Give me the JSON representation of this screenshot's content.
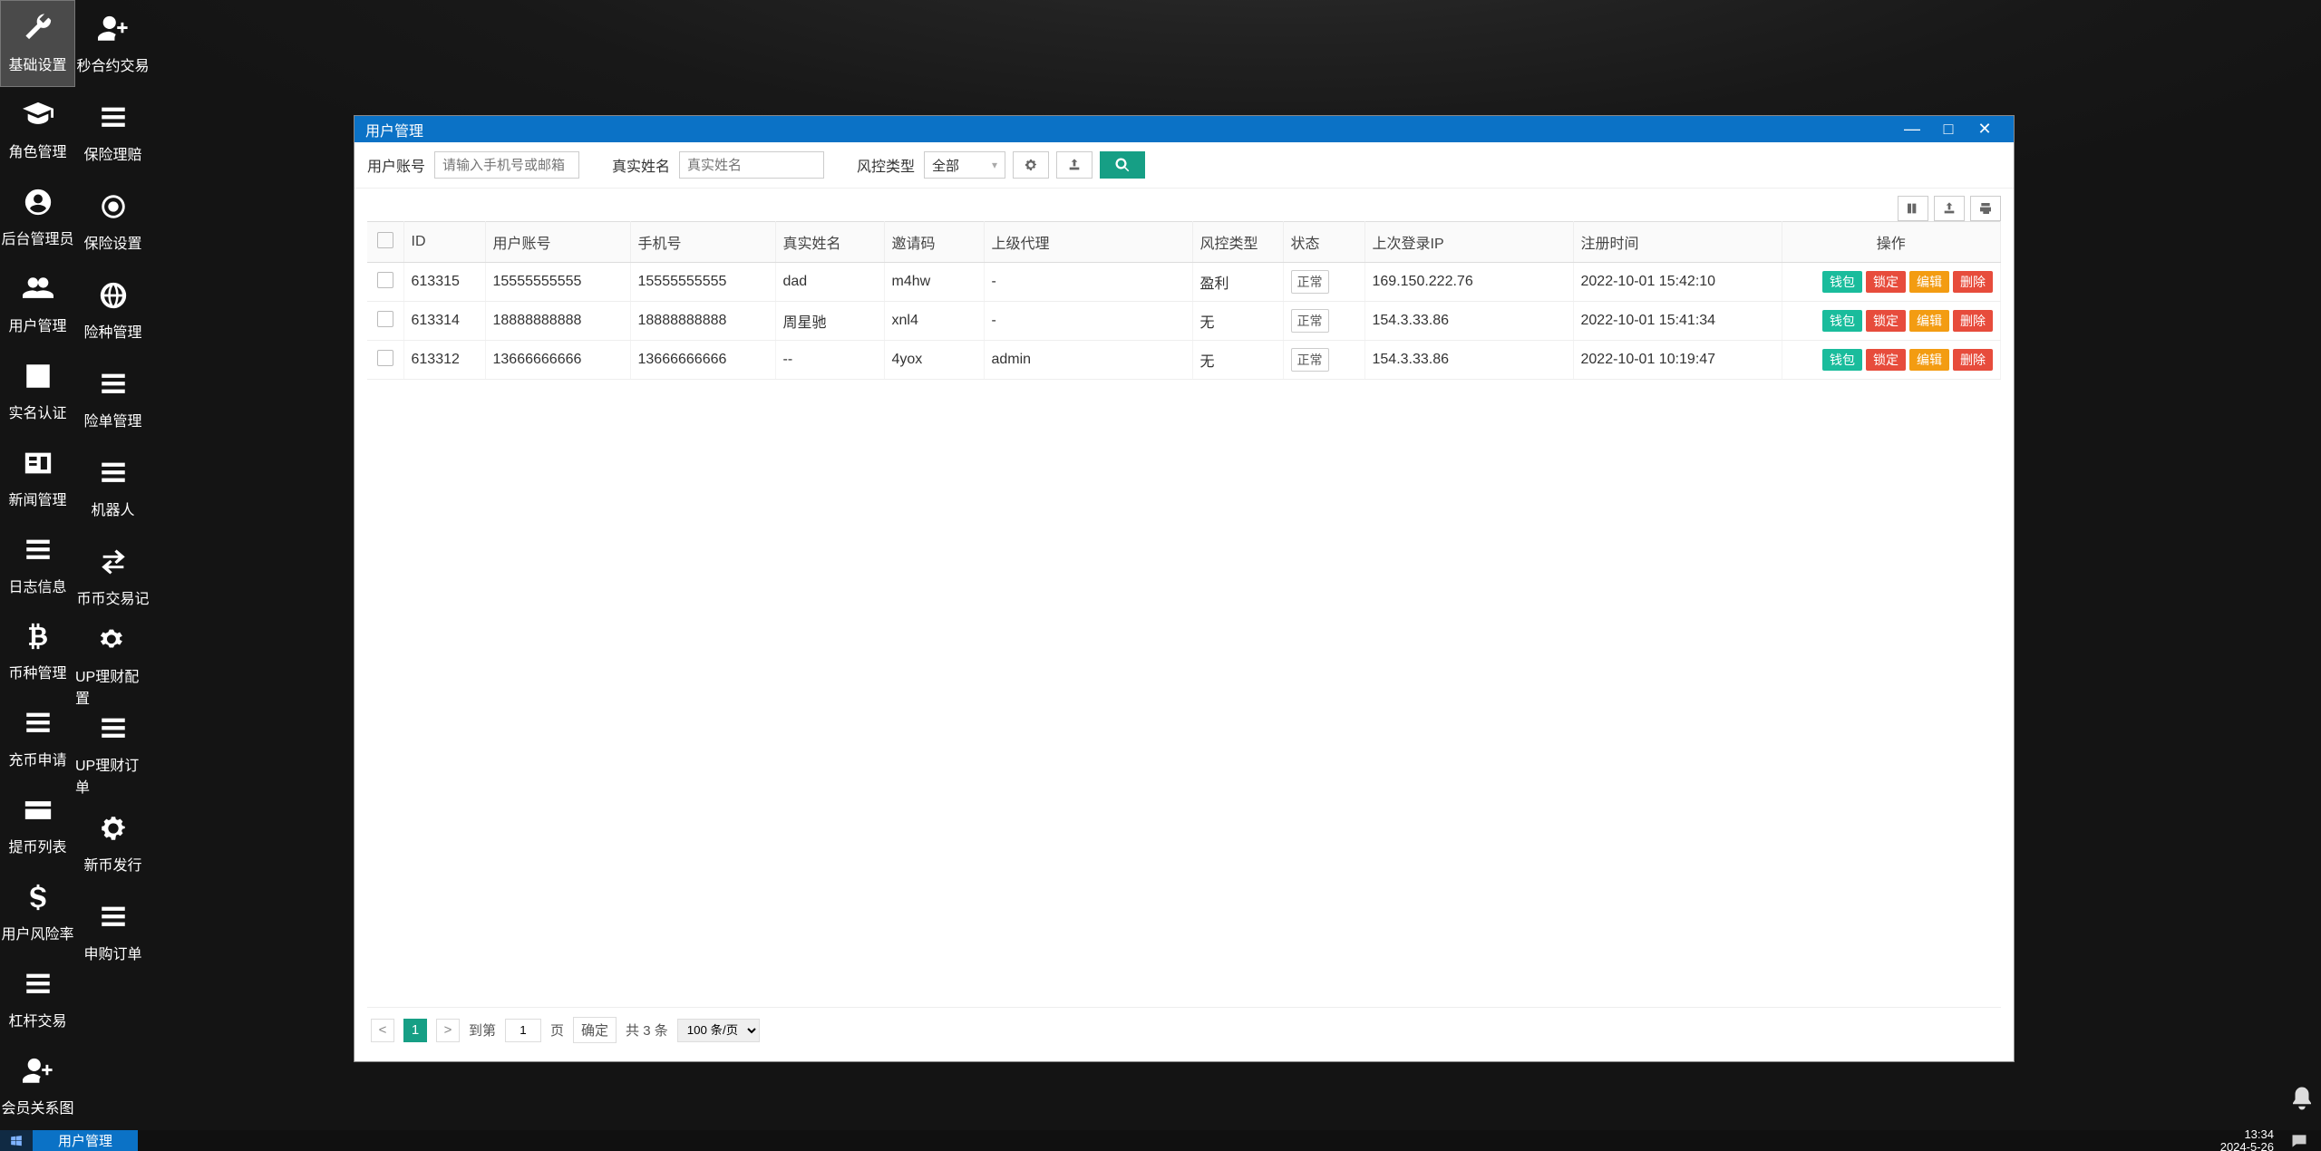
{
  "nav": {
    "left": [
      {
        "icon": "wrench",
        "label": "基础设置",
        "highlight": true
      },
      {
        "icon": "gradcap",
        "label": "角色管理"
      },
      {
        "icon": "usercircle",
        "label": "后台管理员"
      },
      {
        "icon": "users",
        "label": "用户管理"
      },
      {
        "icon": "checksq",
        "label": "实名认证"
      },
      {
        "icon": "idcard",
        "label": "新闻管理"
      },
      {
        "icon": "list",
        "label": "日志信息"
      },
      {
        "icon": "bitcoin",
        "label": "币种管理"
      },
      {
        "icon": "list",
        "label": "充币申请"
      },
      {
        "icon": "card",
        "label": "提币列表"
      },
      {
        "icon": "dollar",
        "label": "用户风险率"
      },
      {
        "icon": "list",
        "label": "杠杆交易"
      },
      {
        "icon": "useradd",
        "label": "会员关系图"
      }
    ],
    "right": [
      {
        "icon": "useradd",
        "label": "秒合约交易"
      },
      {
        "icon": "list",
        "label": "保险理赔"
      },
      {
        "icon": "gearring",
        "label": "保险设置"
      },
      {
        "icon": "globe",
        "label": "险种管理"
      },
      {
        "icon": "list",
        "label": "险单管理"
      },
      {
        "icon": "list",
        "label": "机器人"
      },
      {
        "icon": "swap",
        "label": "币币交易记"
      },
      {
        "icon": "gears",
        "label": "UP理财配置"
      },
      {
        "icon": "list",
        "label": "UP理财订单"
      },
      {
        "icon": "gear",
        "label": "新币发行"
      },
      {
        "icon": "list",
        "label": "申购订单"
      }
    ]
  },
  "window": {
    "title": "用户管理"
  },
  "filters": {
    "account_label": "用户账号",
    "account_placeholder": "请输入手机号或邮箱",
    "name_label": "真实姓名",
    "name_placeholder": "真实姓名",
    "risk_label": "风控类型",
    "risk_selected": "全部"
  },
  "columns": {
    "id": "ID",
    "account": "用户账号",
    "phone": "手机号",
    "realname": "真实姓名",
    "invite": "邀请码",
    "upline": "上级代理",
    "risk": "风控类型",
    "status": "状态",
    "ip": "上次登录IP",
    "regtime": "注册时间",
    "ops": "操作"
  },
  "status_normal": "正常",
  "ops": {
    "wallet": "钱包",
    "lock": "锁定",
    "edit": "编辑",
    "del": "删除"
  },
  "rows": [
    {
      "id": "613315",
      "account": "15555555555",
      "phone": "15555555555",
      "realname": "dad",
      "invite": "m4hw",
      "upline": "-",
      "risk": "盈利",
      "status": "正常",
      "ip": "169.150.222.76",
      "regtime": "2022-10-01 15:42:10"
    },
    {
      "id": "613314",
      "account": "18888888888",
      "phone": "18888888888",
      "realname": "周星驰",
      "invite": "xnl4",
      "upline": "-",
      "risk": "无",
      "status": "正常",
      "ip": "154.3.33.86",
      "regtime": "2022-10-01 15:41:34"
    },
    {
      "id": "613312",
      "account": "13666666666",
      "phone": "13666666666",
      "realname": "--",
      "invite": "4yox",
      "upline": "admin",
      "risk": "无",
      "status": "正常",
      "ip": "154.3.33.86",
      "regtime": "2022-10-01 10:19:47"
    }
  ],
  "pager": {
    "current": "1",
    "goto_label": "到第",
    "page_input": "1",
    "page_unit": "页",
    "confirm": "确定",
    "total": "共 3 条",
    "per_page": "100 条/页"
  },
  "taskbar": {
    "active": "用户管理",
    "time": "13:34",
    "date": "2024-5-26"
  }
}
